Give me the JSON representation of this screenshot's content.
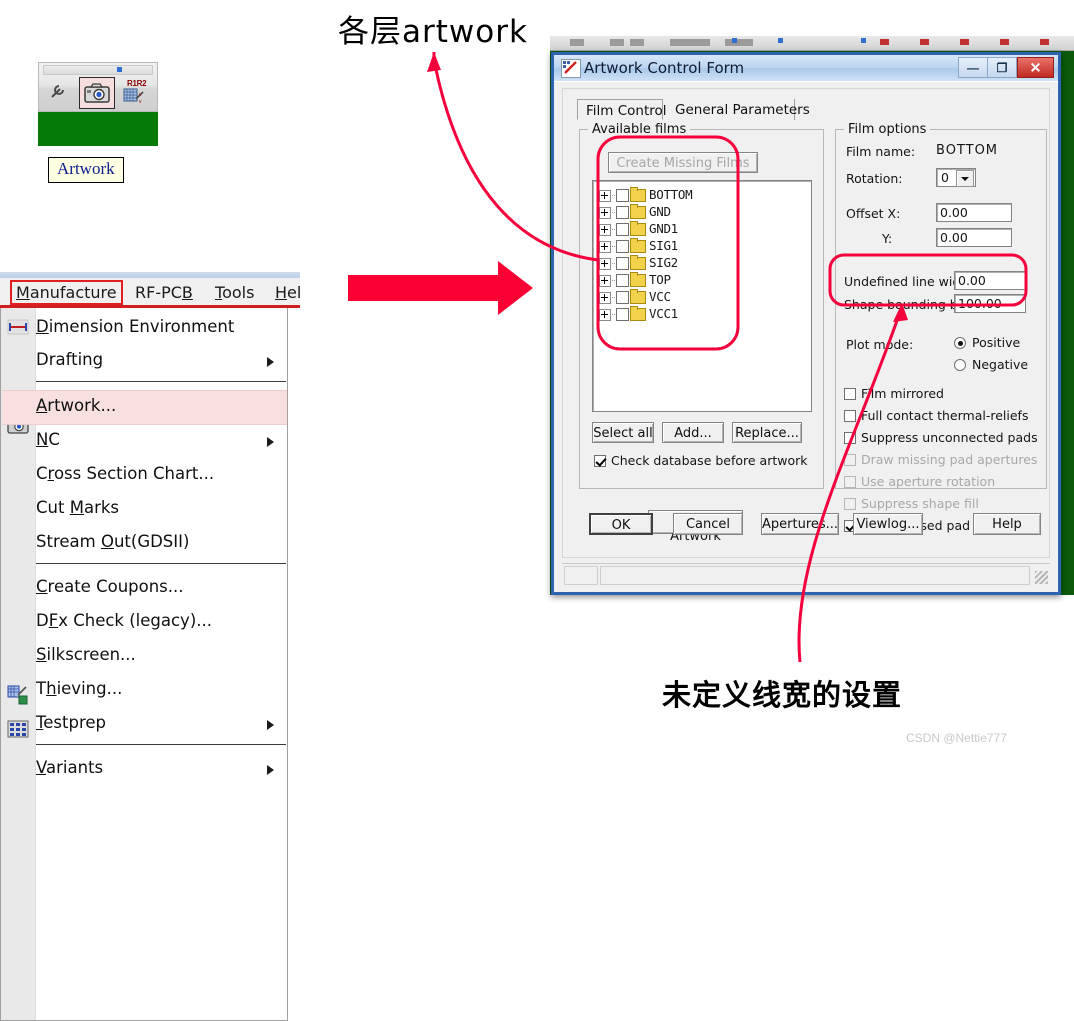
{
  "annotations": {
    "top_text": "各层artwork",
    "bottom_text": "未定义线宽的设置",
    "watermark": "CSDN @Nettie777",
    "accent_color": "#f4003c",
    "arrow_color": "#fb0032"
  },
  "toolbar_snippet": {
    "camera_icon": "camera-icon",
    "resistor_icon": "r1r2-grid-icon",
    "wrench_icon": "wrench-icon",
    "r1r2_label": "R1R2",
    "tooltip": "Artwork"
  },
  "menu_window": {
    "menubar": [
      {
        "name": "manufacture",
        "label": "Manufacture",
        "accel": "M",
        "boxed": true
      },
      {
        "name": "rf-pcb",
        "label": "RF-PCB",
        "accel": "B"
      },
      {
        "name": "tools",
        "label": "Tools",
        "accel": "T"
      },
      {
        "name": "help",
        "label": "Hel",
        "accel": "H"
      }
    ],
    "dropdown": [
      {
        "name": "dimension-environment",
        "label": "Dimension Environment",
        "accel": "D",
        "icon": "dimension-icon",
        "submenu": false,
        "highlight": false
      },
      {
        "name": "drafting",
        "label": "Drafting",
        "accel": "g",
        "submenu": true,
        "highlight": false
      },
      {
        "separator": true
      },
      {
        "name": "artwork",
        "label": "Artwork...",
        "accel": "A",
        "icon": "camera-icon",
        "submenu": false,
        "highlight": true
      },
      {
        "name": "nc",
        "label": "NC",
        "accel": "N",
        "submenu": true,
        "highlight": false
      },
      {
        "name": "cross-section-chart",
        "label": "Cross Section Chart...",
        "accel": "r",
        "submenu": false,
        "highlight": false
      },
      {
        "name": "cut-marks",
        "label": "Cut Marks",
        "accel": "M",
        "submenu": false,
        "highlight": false
      },
      {
        "name": "stream-out",
        "label": "Stream Out(GDSII)",
        "accel": "O",
        "submenu": false,
        "highlight": false
      },
      {
        "separator": true
      },
      {
        "name": "create-coupons",
        "label": "Create Coupons...",
        "accel": "C",
        "submenu": false,
        "highlight": false
      },
      {
        "name": "dfx-check",
        "label": "DFx Check (legacy)...",
        "accel": "F",
        "submenu": false,
        "highlight": false
      },
      {
        "name": "silkscreen",
        "label": "Silkscreen...",
        "accel": "S",
        "icon": "silkscreen-icon",
        "submenu": false,
        "highlight": false
      },
      {
        "name": "thieving",
        "label": "Thieving...",
        "accel": "h",
        "icon": "thieving-icon",
        "submenu": false,
        "highlight": false
      },
      {
        "name": "testprep",
        "label": "Testprep",
        "accel": "T",
        "submenu": true,
        "highlight": false
      },
      {
        "separator": true
      },
      {
        "name": "variants",
        "label": "Variants",
        "accel": "V",
        "submenu": true,
        "highlight": false
      }
    ]
  },
  "dialog": {
    "title": "Artwork Control Form",
    "window_buttons": {
      "minimize": "—",
      "maximize": "❐",
      "close": "✕"
    },
    "tabs": [
      {
        "name": "film-control",
        "label": "Film Control",
        "active": true
      },
      {
        "name": "general-parameters",
        "label": "General Parameters",
        "active": false
      }
    ],
    "available_films": {
      "legend": "Available films",
      "create_missing_films": "Create Missing Films",
      "create_missing_enabled": false,
      "films": [
        {
          "name": "BOTTOM",
          "checked": false
        },
        {
          "name": "GND",
          "checked": false
        },
        {
          "name": "GND1",
          "checked": false
        },
        {
          "name": "SIG1",
          "checked": false
        },
        {
          "name": "SIG2",
          "checked": false
        },
        {
          "name": "TOP",
          "checked": false
        },
        {
          "name": "VCC",
          "checked": false
        },
        {
          "name": "VCC1",
          "checked": false
        }
      ],
      "select_all": "Select all",
      "add": "Add...",
      "replace": "Replace...",
      "check_database": {
        "label": "Check database before artwork",
        "checked": true
      },
      "create_artwork": "Create Artwork"
    },
    "film_options": {
      "legend": "Film options",
      "film_name_label": "Film name:",
      "film_name_value": "BOTTOM",
      "rotation_label": "Rotation:",
      "rotation_value": "0",
      "offset_x_label": "Offset  X:",
      "offset_x_value": "0.00",
      "offset_y_label": "Y:",
      "offset_y_value": "0.00",
      "undefined_line_width_label": "Undefined line width:",
      "undefined_line_width_value": "0.00",
      "shape_bounding_box_label": "Shape bounding box:",
      "shape_bounding_box_value": "100.00",
      "plot_mode_label": "Plot mode:",
      "plot_mode_options": [
        {
          "name": "positive",
          "label": "Positive",
          "selected": true
        },
        {
          "name": "negative",
          "label": "Negative",
          "selected": false
        }
      ],
      "checkboxes": [
        {
          "name": "film-mirrored",
          "label": "Film mirrored",
          "checked": false,
          "enabled": true
        },
        {
          "name": "full-contact-thermal-reliefs",
          "label": "Full contact thermal-reliefs",
          "checked": false,
          "enabled": true
        },
        {
          "name": "suppress-unconnected-pads",
          "label": "Suppress unconnected pads",
          "checked": false,
          "enabled": true
        },
        {
          "name": "draw-missing-pad-apertures",
          "label": "Draw missing pad apertures",
          "checked": false,
          "enabled": false
        },
        {
          "name": "use-aperture-rotation",
          "label": "Use aperture rotation",
          "checked": false,
          "enabled": false
        },
        {
          "name": "suppress-shape-fill",
          "label": "Suppress shape fill",
          "checked": false,
          "enabled": false
        },
        {
          "name": "vector-based-pad-behavior",
          "label": "Vector based pad behavior",
          "checked": true,
          "enabled": true
        }
      ]
    },
    "footer_buttons": [
      {
        "name": "ok",
        "label": "OK",
        "default": true
      },
      {
        "name": "cancel",
        "label": "Cancel"
      },
      {
        "name": "apertures",
        "label": "Apertures..."
      },
      {
        "name": "viewlog",
        "label": "Viewlog..."
      },
      {
        "name": "help",
        "label": "Help"
      }
    ]
  }
}
